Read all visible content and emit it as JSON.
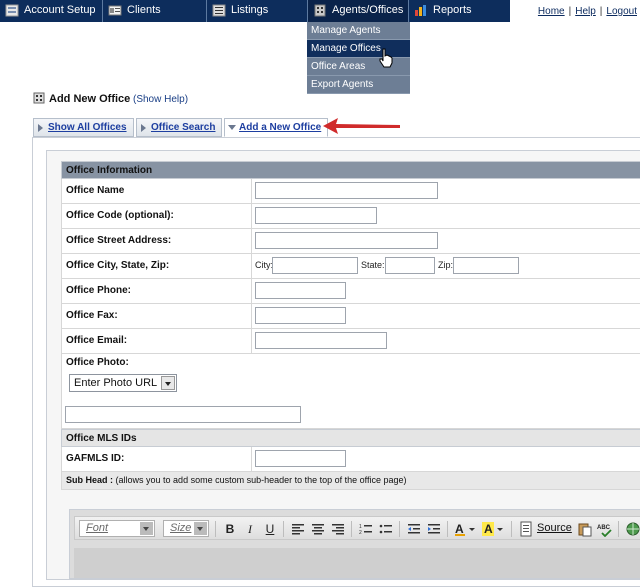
{
  "nav": {
    "items": [
      {
        "label": "Account Setup",
        "icon": "account-setup-icon"
      },
      {
        "label": "Clients",
        "icon": "clients-icon"
      },
      {
        "label": "Listings",
        "icon": "listings-icon"
      },
      {
        "label": "Agents/Offices",
        "icon": "agents-offices-icon"
      },
      {
        "label": "Reports",
        "icon": "reports-icon"
      }
    ],
    "links": {
      "home": "Home",
      "help": "Help",
      "logout": "Logout",
      "sep": "|"
    }
  },
  "dropdown": {
    "items": [
      "Manage Agents",
      "Manage Offices",
      "Office Areas",
      "Export Agents"
    ],
    "hovered": "Manage Offices"
  },
  "page": {
    "title": "Add New Office",
    "help": "(Show Help)"
  },
  "tabs": [
    "Show All Offices",
    "Office Search",
    "Add a New Office"
  ],
  "form": {
    "section_info": "Office Information",
    "fields": {
      "name": "Office Name",
      "code": "Office Code (optional):",
      "street": "Office Street Address:",
      "city": "Office City, State, Zip:",
      "city_lbl": "City:",
      "state_lbl": "State:",
      "zip_lbl": "Zip:",
      "phone": "Office Phone:",
      "fax": "Office Fax:",
      "email": "Office Email:",
      "photo": "Office Photo:",
      "photo_select": "Enter Photo URL"
    },
    "section_mls": "Office MLS IDs",
    "gafmls": "GAFMLS ID:",
    "subhead_title": "Sub Head :",
    "subhead_desc": "(allows you to add some custom sub-header to the top of the office page)"
  },
  "editor": {
    "font": "Font",
    "size": "Size",
    "bold": "B",
    "italic": "I",
    "underline": "U",
    "source": "Source"
  },
  "colors": {
    "nav_bg": "#0d2d5c",
    "dropdown_bg": "#6d7e95",
    "dropdown_hover": "#102e5c",
    "section_head": "#8793a3",
    "tab_link": "#1d3ea0",
    "arrow": "#d02b2b"
  }
}
